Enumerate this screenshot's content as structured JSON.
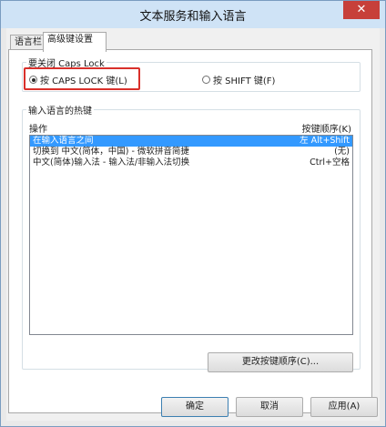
{
  "window": {
    "title": "文本服务和输入语言",
    "close_glyph": "✕"
  },
  "tabs": [
    {
      "label": "语言栏"
    },
    {
      "label": "高级键设置"
    }
  ],
  "caps_lock": {
    "legend": "要关闭 Caps Lock",
    "option_caps": "按 CAPS LOCK 键(L)",
    "option_shift": "按 SHIFT 键(F)",
    "selected": "option_caps"
  },
  "hotkeys": {
    "legend": "输入语言的热键",
    "col_action": "操作",
    "col_sequence": "按键顺序(K)",
    "rows": [
      {
        "action": "在输入语言之间",
        "sequence": "左 Alt+Shift",
        "selected": true
      },
      {
        "action": "切换到 中文(简体，中国) - 微软拼音简捷",
        "sequence": "(无)",
        "selected": false
      },
      {
        "action": "中文(简体)输入法 - 输入法/非输入法切换",
        "sequence": "Ctrl+空格",
        "selected": false
      }
    ],
    "change_button": "更改按键顺序(C)..."
  },
  "footer": {
    "ok": "确定",
    "cancel": "取消",
    "apply": "应用(A)"
  },
  "colors": {
    "selection": "#3399ff",
    "highlight_border": "#d9302b",
    "title_bar": "#cfe3f6",
    "close_button": "#c7403a"
  }
}
